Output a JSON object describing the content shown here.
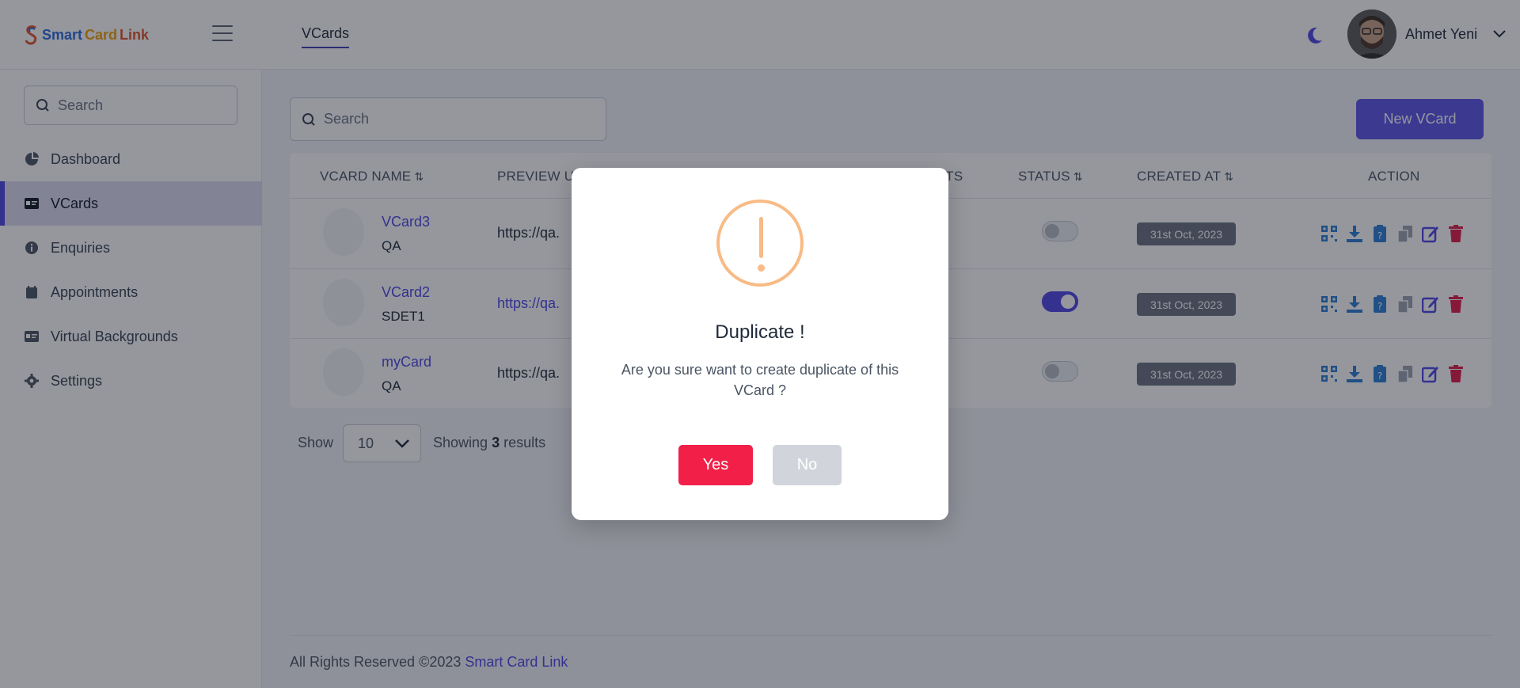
{
  "brand": {
    "part1": "Smart",
    "part2": "Card",
    "part3": "Link"
  },
  "header": {
    "tab": "VCards",
    "user_name": "Ahmet Yeni",
    "icons": {
      "menu": "hamburger-icon",
      "theme": "moon-icon",
      "caret": "chevron-down-icon"
    }
  },
  "sidebar": {
    "search_placeholder": "Search",
    "items": [
      {
        "label": "Dashboard",
        "icon": "pie-chart-icon"
      },
      {
        "label": "VCards",
        "icon": "id-card-icon",
        "active": true
      },
      {
        "label": "Enquiries",
        "icon": "info-icon"
      },
      {
        "label": "Appointments",
        "icon": "calendar-icon"
      },
      {
        "label": "Virtual Backgrounds",
        "icon": "id-card-icon"
      },
      {
        "label": "Settings",
        "icon": "gear-icon"
      }
    ]
  },
  "main": {
    "search_placeholder": "Search",
    "new_button": "New VCard",
    "columns": {
      "name": "VCARD NAME",
      "preview": "PREVIEW UR",
      "stats": "ATS",
      "status": "STATUS",
      "created": "CREATED AT",
      "action": "ACTION",
      "sort_glyph": "⇅"
    },
    "rows": [
      {
        "name": "VCard3",
        "occupation": "QA",
        "url": "https://qa.",
        "status_on": false,
        "created": "31st Oct, 2023"
      },
      {
        "name": "VCard2",
        "occupation": "SDET1",
        "url": "https://qa.",
        "status_on": true,
        "created": "31st Oct, 2023"
      },
      {
        "name": "myCard",
        "occupation": "QA",
        "url": "https://qa.",
        "status_on": false,
        "created": "31st Oct, 2023"
      }
    ],
    "action_icons": [
      "qr-code-icon",
      "download-icon",
      "clipboard-question-icon",
      "copy-icon",
      "edit-icon",
      "trash-icon"
    ],
    "colors": {
      "accent": "#4f46e5",
      "action_blue": "#2a7fd4",
      "delete_red": "#e11d48"
    }
  },
  "pagination": {
    "show_label": "Show",
    "per_page": "10",
    "showing_prefix": "Showing",
    "showing_count": "3",
    "showing_suffix": "results"
  },
  "footer": {
    "text": "All Rights Reserved ©2023",
    "link": "Smart Card Link"
  },
  "modal": {
    "icon": "warning-exclamation-icon",
    "title": "Duplicate !",
    "message": "Are you sure want to create duplicate of this VCard ?",
    "yes_label": "Yes",
    "no_label": "No",
    "colors": {
      "warning": "#f8bb86",
      "yes": "#f22048",
      "no": "#d1d5db"
    }
  }
}
